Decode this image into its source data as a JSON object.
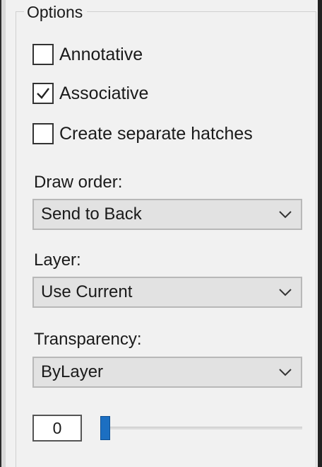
{
  "options": {
    "title": "Options",
    "checkboxes": [
      {
        "label": "Annotative",
        "checked": false
      },
      {
        "label": "Associative",
        "checked": true
      },
      {
        "label": "Create separate hatches",
        "checked": false
      }
    ]
  },
  "draw_order": {
    "label": "Draw order:",
    "selected": "Send to Back"
  },
  "layer": {
    "label": "Layer:",
    "selected": "Use Current"
  },
  "transparency": {
    "label": "Transparency:",
    "selected": "ByLayer",
    "value": "0",
    "slider_fraction": 0
  },
  "colors": {
    "panel": "#f1f1f1",
    "dropdown_bg": "#e2e2e2",
    "slider_thumb": "#1c6fc2"
  },
  "icons": {
    "checkmark": "check-icon",
    "dropdown": "chevron-down-icon"
  }
}
